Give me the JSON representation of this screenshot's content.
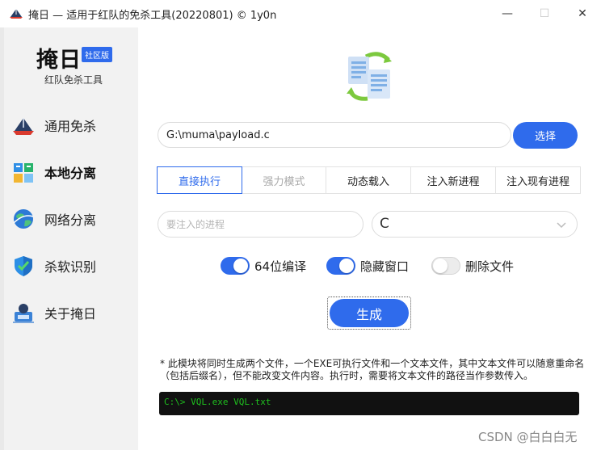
{
  "window": {
    "title": "掩日 — 适用于红队的免杀工具(20220801) © 1y0n",
    "icon": "app-logo-icon",
    "controls": {
      "minimize": "—",
      "maximize": "☐",
      "close": "✕"
    }
  },
  "sidebar": {
    "brand": "掩日",
    "badge": "社区版",
    "subtitle": "红队免杀工具",
    "items": [
      {
        "label": "通用免杀",
        "icon": "ship-icon",
        "active": false
      },
      {
        "label": "本地分离",
        "icon": "blocks-icon",
        "active": true
      },
      {
        "label": "网络分离",
        "icon": "globe-icon",
        "active": false
      },
      {
        "label": "杀软识别",
        "icon": "shield-check-icon",
        "active": false
      },
      {
        "label": "关于掩日",
        "icon": "user-computer-icon",
        "active": false
      }
    ]
  },
  "main": {
    "hero_icon": "file-sync-icon",
    "path_value": "G:\\muma\\payload.c",
    "choose_label": "选择",
    "tabs": [
      {
        "label": "直接执行",
        "state": "active"
      },
      {
        "label": "强力模式",
        "state": "disabled"
      },
      {
        "label": "动态载入",
        "state": "normal"
      },
      {
        "label": "注入新进程",
        "state": "normal"
      },
      {
        "label": "注入现有进程",
        "state": "normal"
      }
    ],
    "process_placeholder": "要注入的进程",
    "language_value": "C",
    "switches": [
      {
        "label": "64位编译",
        "on": true
      },
      {
        "label": "隐藏窗口",
        "on": true
      },
      {
        "label": "删除文件",
        "on": false
      }
    ],
    "generate_label": "生成",
    "note": "* 此模块将同时生成两个文件，一个EXE可执行文件和一个文本文件，其中文本文件可以随意重命名（包括后缀名），但不能改变文件内容。执行时，需要将文本文件的路径当作参数传入。",
    "console_text": "C:\\> VQL.exe VQL.txt"
  },
  "watermark": "CSDN @白白白无",
  "colors": {
    "accent": "#2f6bec",
    "sidebar_bg": "#f2f2f2",
    "console_bg": "#111111",
    "console_fg": "#1fc11f"
  }
}
